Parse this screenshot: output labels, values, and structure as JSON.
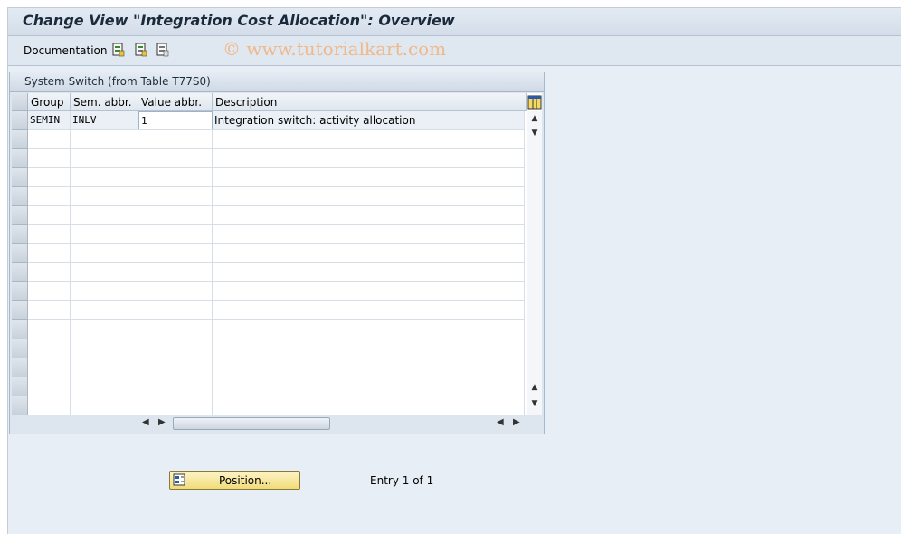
{
  "window": {
    "title": "Change View \"Integration Cost Allocation\": Overview"
  },
  "watermark": "© www.tutorialkart.com",
  "toolbar": {
    "documentation_label": "Documentation",
    "icons": [
      "select-all-icon",
      "select-block-icon",
      "deselect-all-icon"
    ]
  },
  "panel": {
    "title": "System Switch (from Table T77S0)"
  },
  "table": {
    "columns": [
      "Group",
      "Sem. abbr.",
      "Value abbr.",
      "Description"
    ],
    "rows": [
      {
        "group": "SEMIN",
        "sem_abbr": "INLV",
        "value_abbr": "1",
        "description": "Integration switch: activity allocation"
      }
    ],
    "empty_rows": 15,
    "settings_icon": "table-settings-icon"
  },
  "footer": {
    "position_button_label": "Position...",
    "entry_text": "Entry 1 of 1"
  },
  "colors": {
    "background": "#e8eef5",
    "button": "#f6e59a",
    "watermark": "#f0b98a"
  }
}
